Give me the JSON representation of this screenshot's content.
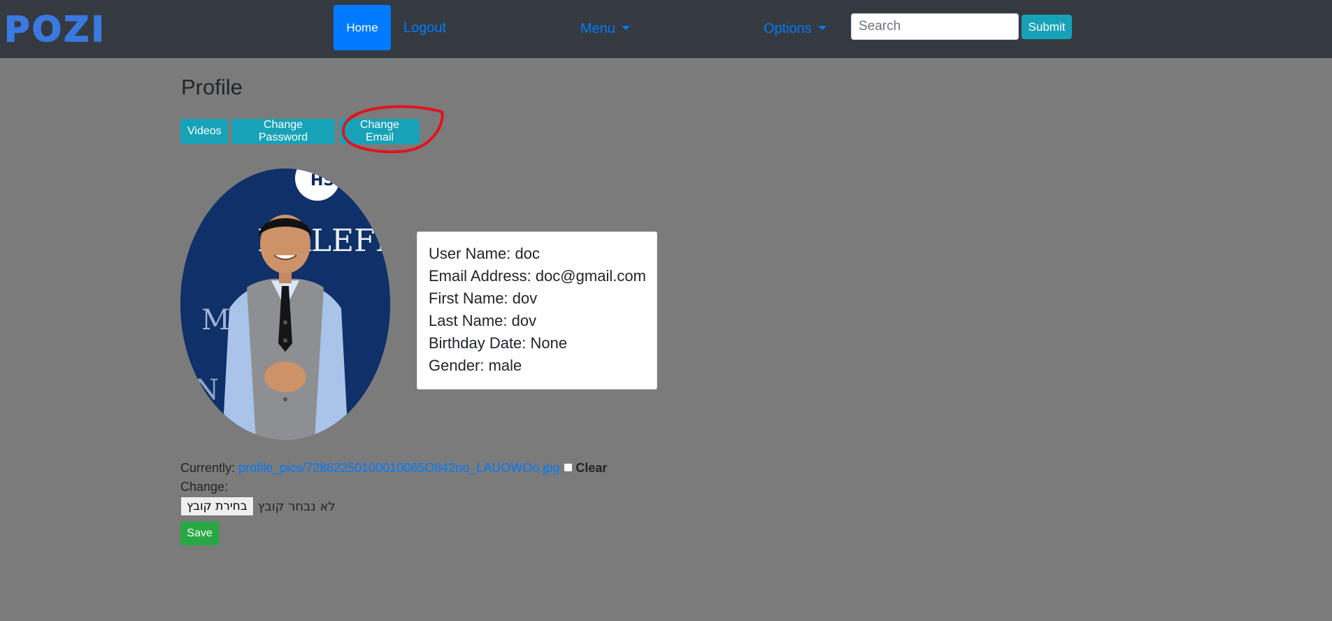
{
  "navbar": {
    "logo": "POZI",
    "home_label": "Home",
    "logout_label": "Logout",
    "menu_label": "Menu",
    "options_label": "Options",
    "search_placeholder": "Search",
    "submit_label": "Submit"
  },
  "profile": {
    "title": "Profile",
    "buttons": {
      "videos": "Videos",
      "change_password": "Change Password",
      "change_email": "Change Email"
    },
    "avatar_text": "MALEFICENT",
    "info": [
      "User Name: doc",
      "Email Address: doc@gmail.com",
      "First Name: dov",
      "Last Name: dov",
      "Birthday Date: None",
      "Gender: male"
    ]
  },
  "form": {
    "currently_label": "Currently:",
    "current_file": "profile_pics/72862250100010065O842no_LAUOWOo.jpg",
    "clear_label": "Clear",
    "change_label": "Change:",
    "file_button_label": "בחירת קובץ",
    "no_file_text": "לא נבחר קובץ",
    "save_label": "Save"
  },
  "colors": {
    "navbar_bg": "#343a40",
    "page_bg": "#7b7b7b",
    "primary": "#007bff",
    "info": "#17a2b8",
    "success": "#28a745",
    "annotation_red": "#e0151b"
  }
}
